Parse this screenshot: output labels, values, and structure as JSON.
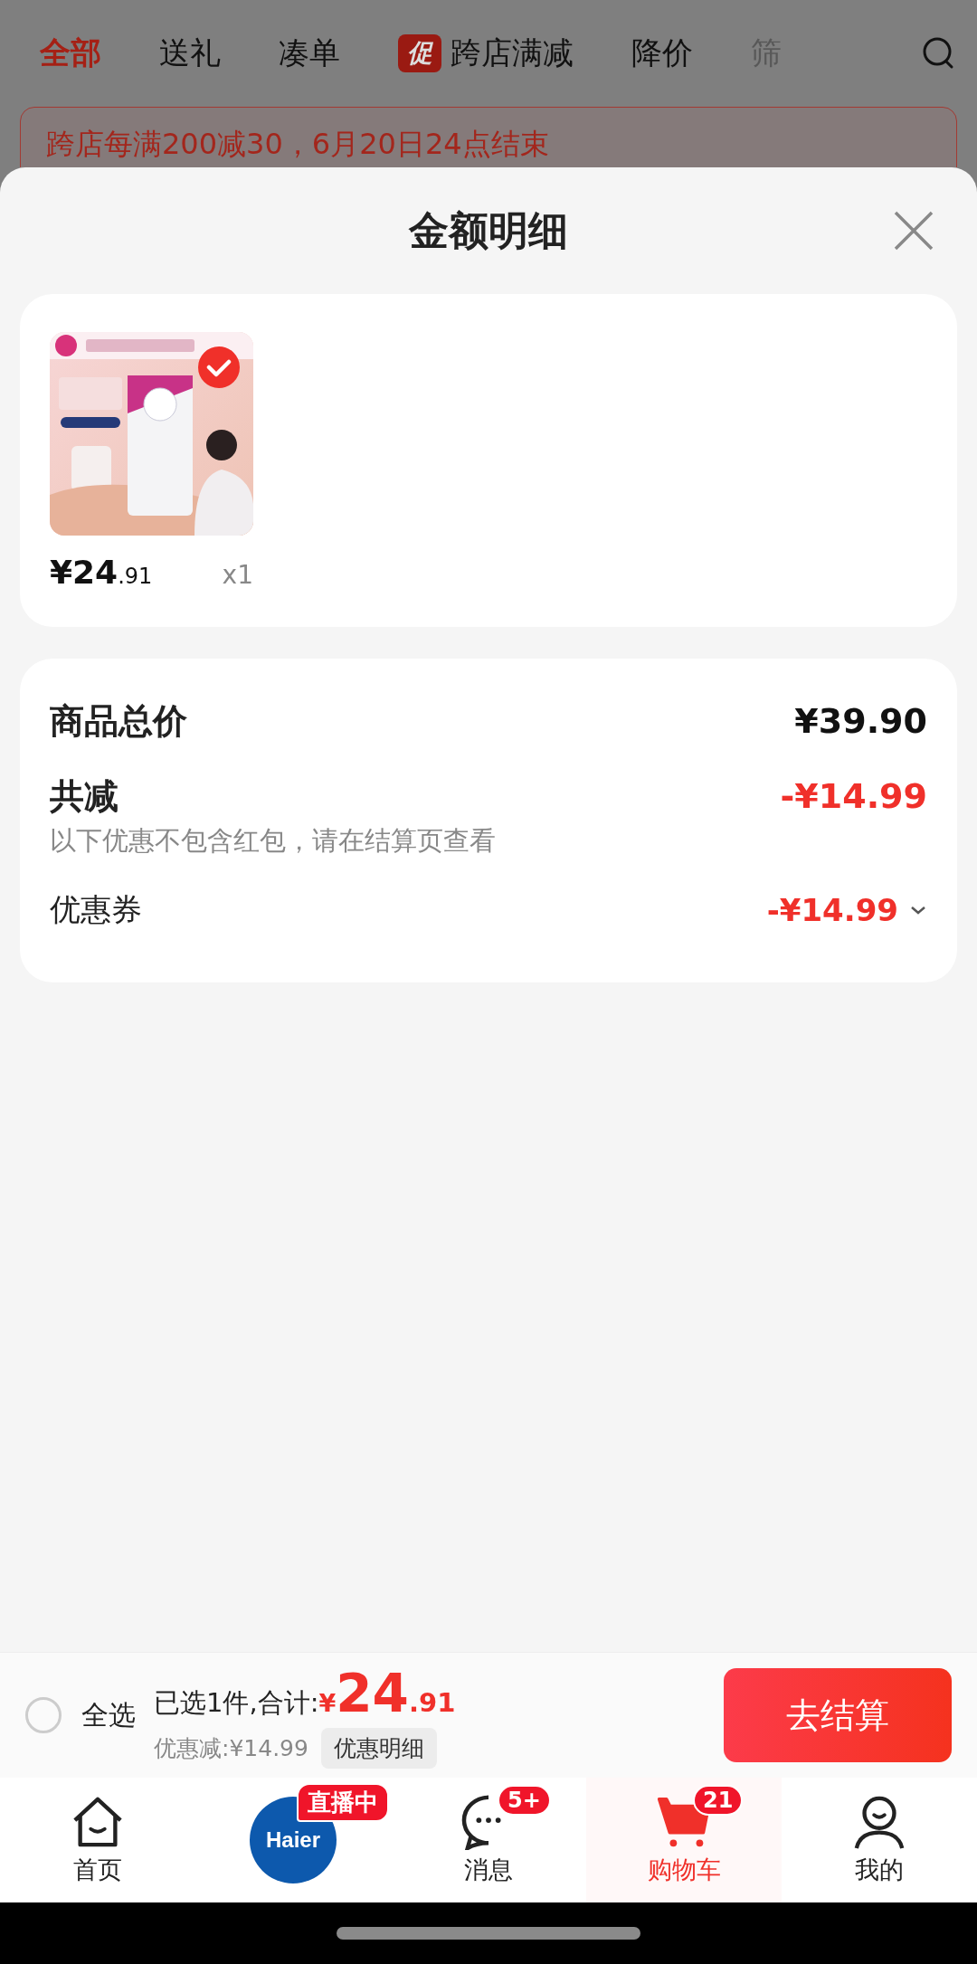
{
  "top_tabs": [
    {
      "label": "全部",
      "selected": true
    },
    {
      "label": "送礼",
      "selected": false
    },
    {
      "label": "凑单",
      "selected": false
    },
    {
      "label": "跨店满减",
      "selected": false,
      "badge": "促"
    },
    {
      "label": "降价",
      "selected": false
    },
    {
      "label": "筛",
      "selected": false
    }
  ],
  "promo_banner": {
    "text": "跨店每满200减30，6月20日24点结束"
  },
  "sheet": {
    "title": "金额明细"
  },
  "items": [
    {
      "kind": "picture",
      "checked": true,
      "price_main": "¥24",
      "price_decimal": ".91",
      "quantity": "x1"
    }
  ],
  "summary": [
    {
      "kind": "total",
      "label": "商品总价",
      "value": "¥39.90"
    },
    {
      "kind": "discount",
      "label": "共减",
      "value": "-¥14.99",
      "note": "以下优惠不包含红包，请在结算页查看"
    },
    {
      "kind": "coupon",
      "label": "优惠券",
      "value": "-¥14.99",
      "expanded": false
    }
  ],
  "bottom_bar": {
    "select_all": {
      "label": "全选",
      "checked": false
    },
    "selected_text": "已选1件,合计:",
    "currency": "¥",
    "amount": "24",
    "decimal": ".91",
    "discount": "优惠减:¥14.99",
    "detail_button": "优惠明细",
    "checkout": "去结算"
  },
  "nav": [
    {
      "kind": "home",
      "label": "首页",
      "selected": false
    },
    {
      "kind": "live",
      "logo": "Haier",
      "badge": "直播中"
    },
    {
      "kind": "chat",
      "label": "消息",
      "badge": "5+",
      "selected": false
    },
    {
      "kind": "cart",
      "label": "购物车",
      "badge": "21",
      "selected": true
    },
    {
      "kind": "user",
      "label": "我的",
      "selected": false
    }
  ]
}
